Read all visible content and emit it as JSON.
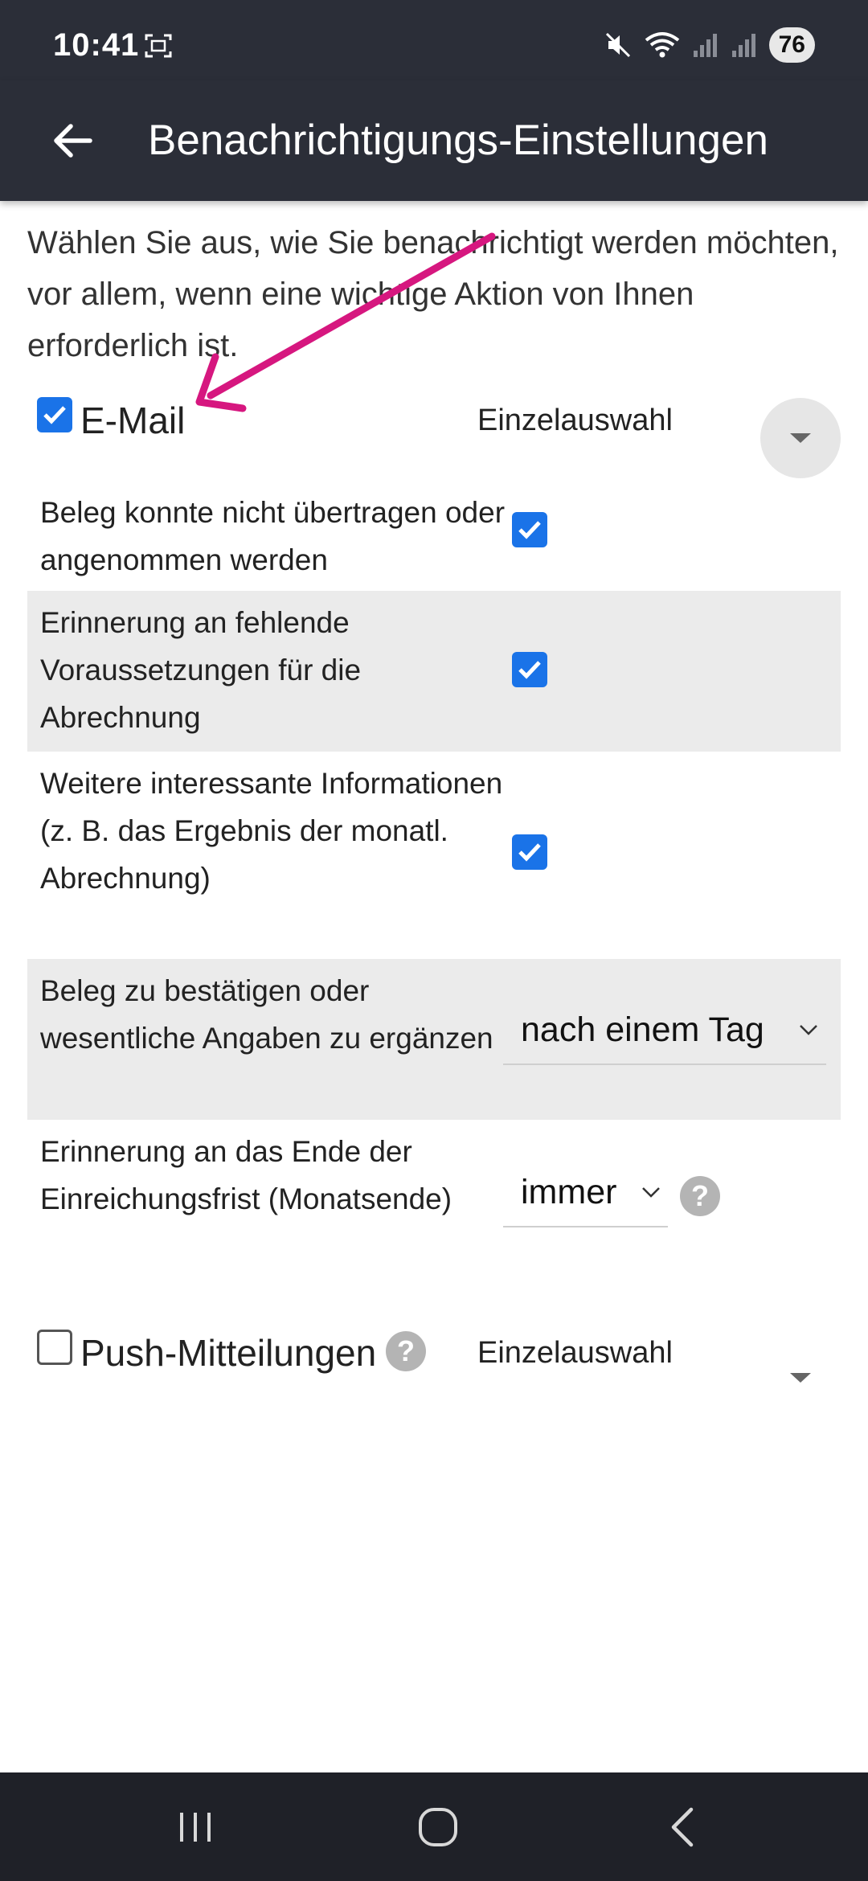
{
  "status_bar": {
    "time": "10:41",
    "battery": "76"
  },
  "app_bar": {
    "title": "Benachrichtigungs-Einstellungen"
  },
  "intro_text": "Wählen Sie aus, wie Sie benachrichtigt werden möchten, vor allem, wenn eine wichtige Aktion von Ihnen erforderlich ist.",
  "channels": {
    "email": {
      "label": "E-Mail",
      "checked": true,
      "mode": "Einzelauswahl"
    },
    "push": {
      "label": "Push-Mitteilungen",
      "checked": false,
      "mode": "Einzelauswahl"
    }
  },
  "email_settings": [
    {
      "text": "Beleg konnte nicht übertragen oder angenommen werden",
      "type": "checkbox",
      "checked": true
    },
    {
      "text": "Erinnerung an fehlende Voraussetzungen für die Abrechnung",
      "type": "checkbox",
      "checked": true
    },
    {
      "text": "Weitere interessante Informationen (z. B. das Ergebnis der monatl. Abrechnung)",
      "type": "checkbox",
      "checked": true
    },
    {
      "text": "Beleg zu bestätigen oder wesentliche Angaben zu ergänzen",
      "type": "select",
      "value": "nach einem Tag"
    },
    {
      "text": "Erinnerung an das Ende der Einreichungsfrist (Monatsende)",
      "type": "select",
      "value": "immer"
    }
  ],
  "help_glyph": "?",
  "colors": {
    "header_bg": "#2b2e38",
    "checkbox_accent": "#1a73e8",
    "annotation_arrow": "#d6177f",
    "alt_row_bg": "#ebebeb"
  },
  "icons": [
    "back-arrow-icon",
    "screenshot-icon",
    "mute-icon",
    "wifi-icon",
    "signal-icon",
    "chevron-down-icon",
    "help-icon",
    "recents-icon",
    "home-icon",
    "back-nav-icon"
  ]
}
